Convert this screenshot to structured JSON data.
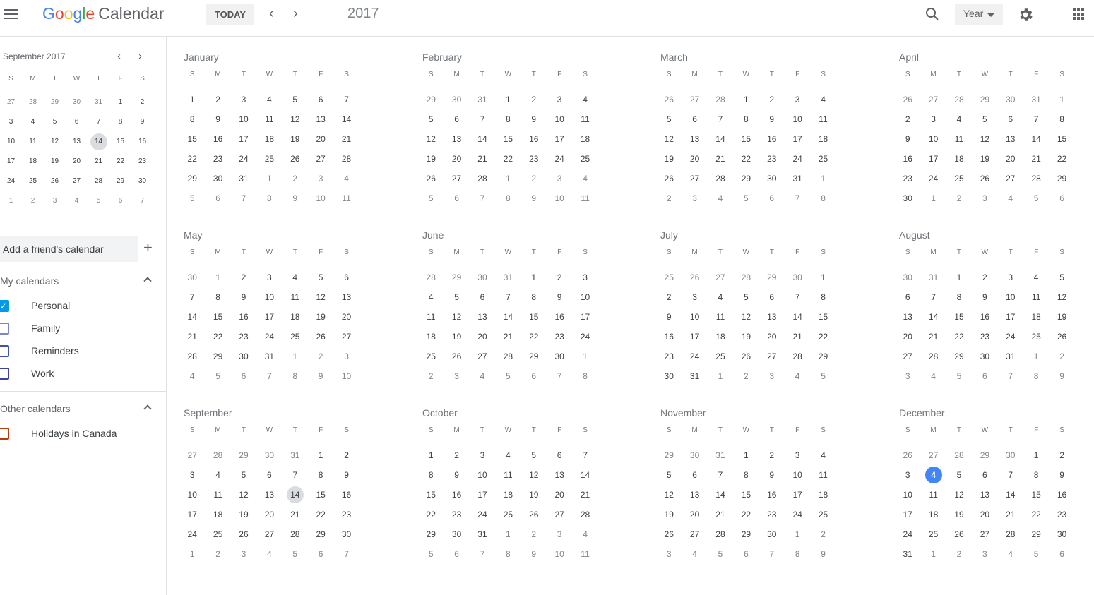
{
  "header": {
    "logo_letters": [
      "G",
      "o",
      "o",
      "g",
      "l",
      "e"
    ],
    "app_name": "Calendar",
    "today_label": "TODAY",
    "prev_icon": "chevron-left-icon",
    "next_icon": "chevron-right-icon",
    "title": "2017",
    "view_select": "Year"
  },
  "mini_calendar": {
    "title": "September 2017",
    "dow": [
      "S",
      "M",
      "T",
      "W",
      "T",
      "F",
      "S"
    ],
    "weeks": [
      [
        27,
        28,
        29,
        30,
        31,
        1,
        2
      ],
      [
        3,
        4,
        5,
        6,
        7,
        8,
        9
      ],
      [
        10,
        11,
        12,
        13,
        14,
        15,
        16
      ],
      [
        17,
        18,
        19,
        20,
        21,
        22,
        23
      ],
      [
        24,
        25,
        26,
        27,
        28,
        29,
        30
      ],
      [
        1,
        2,
        3,
        4,
        5,
        6,
        7
      ]
    ],
    "selected_day": 14
  },
  "sidebar": {
    "friend_placeholder": "Add a friend's calendar",
    "my_calendars_label": "My calendars",
    "my_calendars": [
      {
        "label": "Personal",
        "checked": true,
        "color": "#039be5"
      },
      {
        "label": "Family",
        "checked": false,
        "color": "#7986cb"
      },
      {
        "label": "Reminders",
        "checked": false,
        "color": "#3f51b5"
      },
      {
        "label": "Work",
        "checked": false,
        "color": "#3f3fa8"
      }
    ],
    "other_calendars_label": "Other calendars",
    "other_calendars": [
      {
        "label": "Holidays in Canada",
        "checked": false,
        "color": "#b33f0e"
      }
    ]
  },
  "year": {
    "dow": [
      "S",
      "M",
      "T",
      "W",
      "T",
      "F",
      "S"
    ],
    "selected": {
      "month": 8,
      "day": 14
    },
    "today": {
      "month": 11,
      "day": 4
    },
    "months": [
      {
        "name": "January",
        "weeks": [
          [
            1,
            2,
            3,
            4,
            5,
            6,
            7
          ],
          [
            8,
            9,
            10,
            11,
            12,
            13,
            14
          ],
          [
            15,
            16,
            17,
            18,
            19,
            20,
            21
          ],
          [
            22,
            23,
            24,
            25,
            26,
            27,
            28
          ],
          [
            29,
            30,
            31,
            1,
            2,
            3,
            4
          ],
          [
            5,
            6,
            7,
            8,
            9,
            10,
            11
          ]
        ]
      },
      {
        "name": "February",
        "weeks": [
          [
            29,
            30,
            31,
            1,
            2,
            3,
            4
          ],
          [
            5,
            6,
            7,
            8,
            9,
            10,
            11
          ],
          [
            12,
            13,
            14,
            15,
            16,
            17,
            18
          ],
          [
            19,
            20,
            21,
            22,
            23,
            24,
            25
          ],
          [
            26,
            27,
            28,
            1,
            2,
            3,
            4
          ],
          [
            5,
            6,
            7,
            8,
            9,
            10,
            11
          ]
        ]
      },
      {
        "name": "March",
        "weeks": [
          [
            26,
            27,
            28,
            1,
            2,
            3,
            4
          ],
          [
            5,
            6,
            7,
            8,
            9,
            10,
            11
          ],
          [
            12,
            13,
            14,
            15,
            16,
            17,
            18
          ],
          [
            19,
            20,
            21,
            22,
            23,
            24,
            25
          ],
          [
            26,
            27,
            28,
            29,
            30,
            31,
            1
          ],
          [
            2,
            3,
            4,
            5,
            6,
            7,
            8
          ]
        ]
      },
      {
        "name": "April",
        "weeks": [
          [
            26,
            27,
            28,
            29,
            30,
            31,
            1
          ],
          [
            2,
            3,
            4,
            5,
            6,
            7,
            8
          ],
          [
            9,
            10,
            11,
            12,
            13,
            14,
            15
          ],
          [
            16,
            17,
            18,
            19,
            20,
            21,
            22
          ],
          [
            23,
            24,
            25,
            26,
            27,
            28,
            29
          ],
          [
            30,
            1,
            2,
            3,
            4,
            5,
            6
          ]
        ]
      },
      {
        "name": "May",
        "weeks": [
          [
            30,
            1,
            2,
            3,
            4,
            5,
            6
          ],
          [
            7,
            8,
            9,
            10,
            11,
            12,
            13
          ],
          [
            14,
            15,
            16,
            17,
            18,
            19,
            20
          ],
          [
            21,
            22,
            23,
            24,
            25,
            26,
            27
          ],
          [
            28,
            29,
            30,
            31,
            1,
            2,
            3
          ],
          [
            4,
            5,
            6,
            7,
            8,
            9,
            10
          ]
        ]
      },
      {
        "name": "June",
        "weeks": [
          [
            28,
            29,
            30,
            31,
            1,
            2,
            3
          ],
          [
            4,
            5,
            6,
            7,
            8,
            9,
            10
          ],
          [
            11,
            12,
            13,
            14,
            15,
            16,
            17
          ],
          [
            18,
            19,
            20,
            21,
            22,
            23,
            24
          ],
          [
            25,
            26,
            27,
            28,
            29,
            30,
            1
          ],
          [
            2,
            3,
            4,
            5,
            6,
            7,
            8
          ]
        ]
      },
      {
        "name": "July",
        "weeks": [
          [
            25,
            26,
            27,
            28,
            29,
            30,
            1
          ],
          [
            2,
            3,
            4,
            5,
            6,
            7,
            8
          ],
          [
            9,
            10,
            11,
            12,
            13,
            14,
            15
          ],
          [
            16,
            17,
            18,
            19,
            20,
            21,
            22
          ],
          [
            23,
            24,
            25,
            26,
            27,
            28,
            29
          ],
          [
            30,
            31,
            1,
            2,
            3,
            4,
            5
          ]
        ]
      },
      {
        "name": "August",
        "weeks": [
          [
            30,
            31,
            1,
            2,
            3,
            4,
            5
          ],
          [
            6,
            7,
            8,
            9,
            10,
            11,
            12
          ],
          [
            13,
            14,
            15,
            16,
            17,
            18,
            19
          ],
          [
            20,
            21,
            22,
            23,
            24,
            25,
            26
          ],
          [
            27,
            28,
            29,
            30,
            31,
            1,
            2
          ],
          [
            3,
            4,
            5,
            6,
            7,
            8,
            9
          ]
        ]
      },
      {
        "name": "September",
        "weeks": [
          [
            27,
            28,
            29,
            30,
            31,
            1,
            2
          ],
          [
            3,
            4,
            5,
            6,
            7,
            8,
            9
          ],
          [
            10,
            11,
            12,
            13,
            14,
            15,
            16
          ],
          [
            17,
            18,
            19,
            20,
            21,
            22,
            23
          ],
          [
            24,
            25,
            26,
            27,
            28,
            29,
            30
          ],
          [
            1,
            2,
            3,
            4,
            5,
            6,
            7
          ]
        ]
      },
      {
        "name": "October",
        "weeks": [
          [
            1,
            2,
            3,
            4,
            5,
            6,
            7
          ],
          [
            8,
            9,
            10,
            11,
            12,
            13,
            14
          ],
          [
            15,
            16,
            17,
            18,
            19,
            20,
            21
          ],
          [
            22,
            23,
            24,
            25,
            26,
            27,
            28
          ],
          [
            29,
            30,
            31,
            1,
            2,
            3,
            4
          ],
          [
            5,
            6,
            7,
            8,
            9,
            10,
            11
          ]
        ]
      },
      {
        "name": "November",
        "weeks": [
          [
            29,
            30,
            31,
            1,
            2,
            3,
            4
          ],
          [
            5,
            6,
            7,
            8,
            9,
            10,
            11
          ],
          [
            12,
            13,
            14,
            15,
            16,
            17,
            18
          ],
          [
            19,
            20,
            21,
            22,
            23,
            24,
            25
          ],
          [
            26,
            27,
            28,
            29,
            30,
            1,
            2
          ],
          [
            3,
            4,
            5,
            6,
            7,
            8,
            9
          ]
        ]
      },
      {
        "name": "December",
        "weeks": [
          [
            26,
            27,
            28,
            29,
            30,
            1,
            2
          ],
          [
            3,
            4,
            5,
            6,
            7,
            8,
            9
          ],
          [
            10,
            11,
            12,
            13,
            14,
            15,
            16
          ],
          [
            17,
            18,
            19,
            20,
            21,
            22,
            23
          ],
          [
            24,
            25,
            26,
            27,
            28,
            29,
            30
          ],
          [
            31,
            1,
            2,
            3,
            4,
            5,
            6
          ]
        ]
      }
    ]
  }
}
